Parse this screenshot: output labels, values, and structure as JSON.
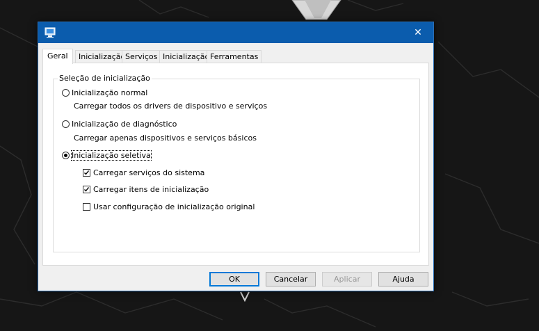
{
  "window": {
    "app_icon": "msconfig-computer-icon",
    "close_icon": "close-icon",
    "close_glyph": "✕"
  },
  "tabs": [
    {
      "label": "Geral",
      "active": true
    },
    {
      "label": "Inicialização",
      "active": false
    },
    {
      "label": "Serviços",
      "active": false
    },
    {
      "label": "Inicialização",
      "active": false
    },
    {
      "label": "Ferramentas",
      "active": false
    }
  ],
  "startup_group": {
    "legend": "Seleção de inicialização",
    "options": [
      {
        "label": "Inicialização normal",
        "description": "Carregar todos os drivers de dispositivo e serviços",
        "selected": false
      },
      {
        "label": "Inicialização de diagnóstico",
        "description": "Carregar apenas dispositivos e serviços básicos",
        "selected": false
      },
      {
        "label": "Inicialização seletiva",
        "selected": true
      }
    ],
    "selective_checks": [
      {
        "label": "Carregar serviços do sistema",
        "checked": true
      },
      {
        "label": "Carregar itens de inicialização",
        "checked": true
      },
      {
        "label": "Usar configuração de inicialização original",
        "checked": false
      }
    ]
  },
  "buttons": {
    "ok": "OK",
    "cancel": "Cancelar",
    "apply": "Aplicar",
    "help": "Ajuda"
  },
  "colors": {
    "titlebar": "#0b5cad",
    "accent": "#0078d7"
  }
}
